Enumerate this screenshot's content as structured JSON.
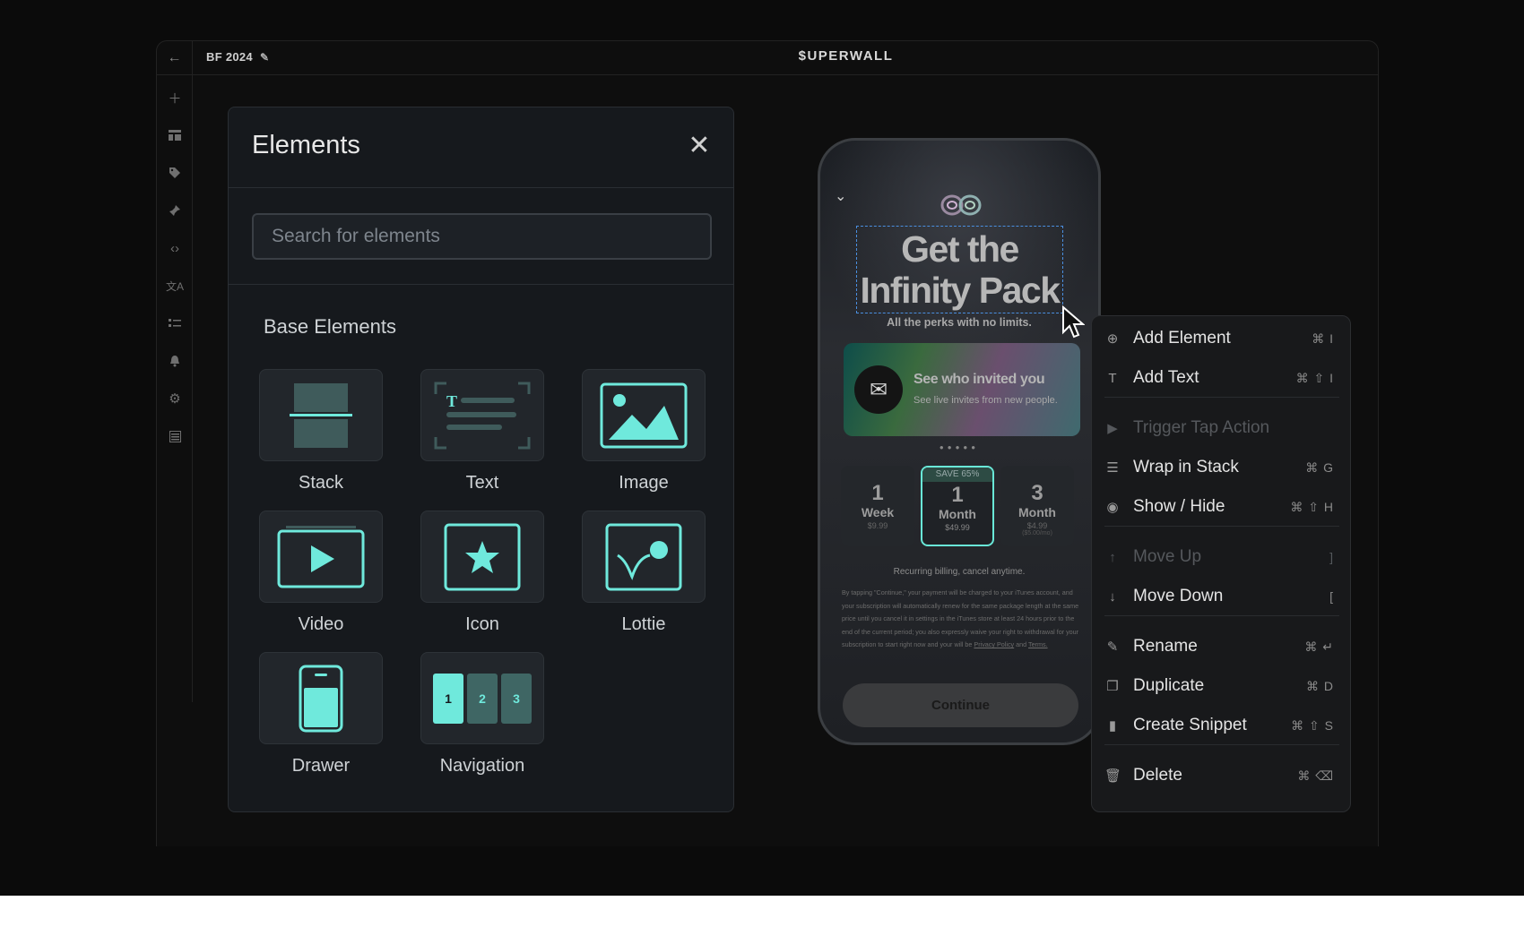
{
  "app": {
    "doc_title": "BF 2024",
    "brand": "$UPERWALL"
  },
  "rail_icons": [
    "plus-icon",
    "layout-icon",
    "tag-icon",
    "pin-icon",
    "code-icon",
    "translate-icon",
    "checklist-icon",
    "bell-icon",
    "gear-icon",
    "table-icon"
  ],
  "panel": {
    "title": "Elements",
    "search_placeholder": "Search for elements",
    "section_title": "Base Elements",
    "tiles": [
      {
        "label": "Stack"
      },
      {
        "label": "Text"
      },
      {
        "label": "Image"
      },
      {
        "label": "Video"
      },
      {
        "label": "Icon"
      },
      {
        "label": "Lottie"
      },
      {
        "label": "Drawer"
      },
      {
        "label": "Navigation"
      }
    ],
    "nav_numbers": [
      "1",
      "2",
      "3"
    ],
    "accent": "#6fe9dc"
  },
  "phone": {
    "headline": "Get the Infinity Pack",
    "subtitle": "All the perks with no limits.",
    "banner_title": "See who invited you",
    "banner_sub": "See live invites from new people.",
    "plans": [
      {
        "num": "1",
        "unit": "Week",
        "price": "$9.99",
        "per": ""
      },
      {
        "badge": "SAVE 65%",
        "num": "1",
        "unit": "Month",
        "price": "$49.99",
        "per": ""
      },
      {
        "num": "3",
        "unit": "Month",
        "price": "$4.99",
        "per": "($5.00/mo)"
      }
    ],
    "recurring": "Recurring billing, cancel anytime.",
    "legal": "By tapping \"Continue,\" your payment will be charged to your iTunes account, and your subscription will automatically renew for the same package length at the same price until you cancel it in settings in the iTunes store at least 24 hours prior to the end of the current period; you also expressly waive your right to withdrawal for your subscription to start right now and your will be",
    "privacy": "Privacy Policy",
    "and": "and",
    "terms": "Terms.",
    "cta": "Continue"
  },
  "menu": {
    "items": [
      {
        "label": "Add Element",
        "key": "⌘ I",
        "icon": "plus-circle-icon",
        "disabled": false
      },
      {
        "label": "Add Text",
        "key": "⌘ ⇧ I",
        "icon": "text-icon",
        "disabled": false
      },
      {
        "label": "Trigger Tap Action",
        "key": "",
        "icon": "play-icon",
        "disabled": true
      },
      {
        "label": "Wrap in Stack",
        "key": "⌘ G",
        "icon": "stack-icon",
        "disabled": false
      },
      {
        "label": "Show / Hide",
        "key": "⌘ ⇧ H",
        "icon": "eye-icon",
        "disabled": false
      },
      {
        "label": "Move Up",
        "key": "]",
        "icon": "arrow-up-icon",
        "disabled": true
      },
      {
        "label": "Move Down",
        "key": "[",
        "icon": "arrow-down-icon",
        "disabled": false
      },
      {
        "label": "Rename",
        "key": "⌘ ↵",
        "icon": "pencil-icon",
        "disabled": false
      },
      {
        "label": "Duplicate",
        "key": "⌘ D",
        "icon": "duplicate-icon",
        "disabled": false
      },
      {
        "label": "Create Snippet",
        "key": "⌘ ⇧ S",
        "icon": "bookmark-icon",
        "disabled": false
      },
      {
        "label": "Delete",
        "key": "⌘ ⌫",
        "icon": "trash-icon",
        "disabled": false
      }
    ]
  }
}
